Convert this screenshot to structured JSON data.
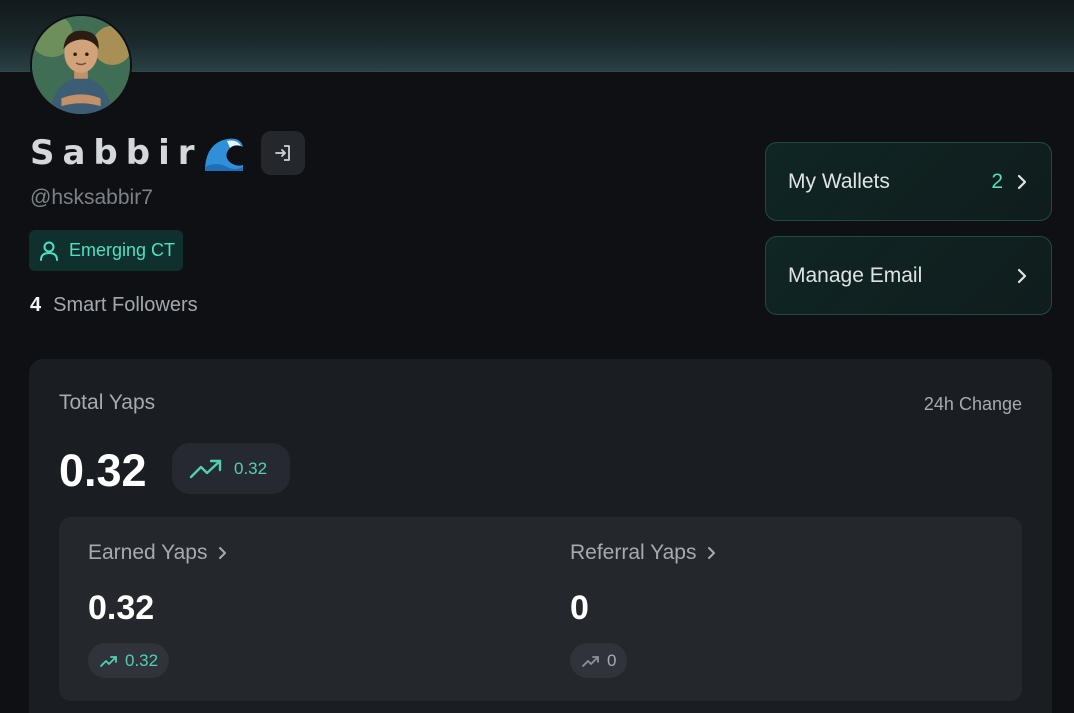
{
  "profile": {
    "name": "Sabbir",
    "name_emoji": "🌊",
    "handle": "@hsksabbir7",
    "badge": "Emerging CT",
    "followers_count": "4",
    "followers_label": "Smart Followers"
  },
  "actions": {
    "wallets_label": "My Wallets",
    "wallets_count": "2",
    "email_label": "Manage Email"
  },
  "yaps": {
    "title": "Total Yaps",
    "change_label": "24h Change",
    "total": "0.32",
    "total_change": "0.32",
    "earned_label": "Earned Yaps",
    "earned_value": "0.32",
    "earned_change": "0.32",
    "referral_label": "Referral Yaps",
    "referral_value": "0",
    "referral_change": "0"
  },
  "colors": {
    "accent": "#4fe0bf",
    "background": "#0e1014",
    "card": "#1a1d22"
  }
}
